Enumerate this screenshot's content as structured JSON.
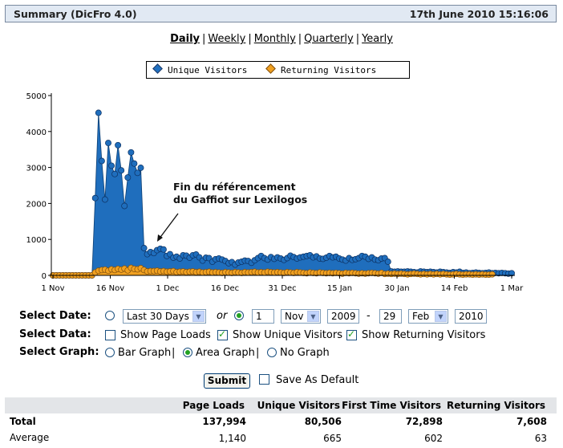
{
  "header": {
    "title": "Summary (DicFro 4.0)",
    "date": "17th June 2010 15:16:06"
  },
  "periods": [
    "Daily",
    "Weekly",
    "Monthly",
    "Quarterly",
    "Yearly"
  ],
  "legend": {
    "unique": "Unique Visitors",
    "returning": "Returning Visitors"
  },
  "colors": {
    "unique": "#1f6ebd",
    "returning": "#f0a020",
    "axis": "#000000"
  },
  "chart_data": {
    "type": "area",
    "ylim": [
      0,
      5000
    ],
    "yticks": [
      "0",
      "1000",
      "2000",
      "3000",
      "4000",
      "5000"
    ],
    "xticks": [
      "1 Nov",
      "16 Nov",
      "1 Dec",
      "16 Dec",
      "31 Dec",
      "15 Jan",
      "30 Jan",
      "14 Feb",
      "1 Mar"
    ],
    "annotation": "Fin du référencement\ndu Gaffiot sur Lexilogos",
    "series": [
      {
        "name": "Unique Visitors",
        "values": [
          0,
          0,
          0,
          0,
          0,
          0,
          0,
          0,
          0,
          0,
          0,
          0,
          0,
          2150,
          4520,
          3180,
          2110,
          3680,
          3050,
          2820,
          3620,
          2920,
          1930,
          2720,
          3420,
          3110,
          2850,
          2990,
          760,
          590,
          650,
          620,
          700,
          740,
          720,
          540,
          590,
          490,
          520,
          470,
          560,
          550,
          490,
          560,
          580,
          500,
          410,
          490,
          480,
          380,
          450,
          470,
          440,
          400,
          340,
          370,
          300,
          360,
          380,
          410,
          400,
          350,
          420,
          480,
          540,
          480,
          440,
          510,
          460,
          500,
          470,
          430,
          480,
          550,
          510,
          470,
          500,
          520,
          540,
          560,
          500,
          530,
          470,
          460,
          490,
          540,
          500,
          520,
          470,
          440,
          410,
          480,
          430,
          450,
          480,
          540,
          520,
          460,
          500,
          440,
          420,
          470,
          480,
          380,
          110,
          100,
          110,
          100,
          100,
          110,
          100,
          90,
          80,
          110,
          100,
          90,
          100,
          90,
          80,
          100,
          90,
          80,
          70,
          90,
          80,
          100,
          70,
          80,
          60,
          70,
          80,
          70,
          60,
          70,
          80,
          60,
          70,
          60,
          70,
          60,
          50,
          60
        ]
      },
      {
        "name": "Returning Visitors",
        "values": [
          0,
          0,
          0,
          0,
          0,
          0,
          0,
          0,
          0,
          0,
          0,
          0,
          0,
          80,
          130,
          150,
          160,
          130,
          170,
          150,
          180,
          160,
          190,
          140,
          210,
          180,
          170,
          200,
          150,
          110,
          120,
          120,
          130,
          110,
          120,
          100,
          110,
          120,
          90,
          100,
          110,
          90,
          100,
          110,
          90,
          100,
          80,
          90,
          100,
          80,
          90,
          80,
          70,
          90,
          80,
          70,
          90,
          80,
          70,
          90,
          80,
          90,
          100,
          80,
          90,
          80,
          100,
          90,
          80,
          90,
          80,
          70,
          90,
          80,
          70,
          90,
          80,
          70,
          60,
          80,
          70,
          60,
          80,
          70,
          60,
          70,
          60,
          70,
          60,
          50,
          70,
          60,
          70,
          60,
          50,
          60,
          50,
          60,
          70,
          60,
          50,
          70,
          40,
          50,
          40,
          50,
          40,
          50,
          40,
          30,
          40,
          50,
          40,
          30,
          40,
          30,
          40,
          30,
          40,
          30,
          40,
          30,
          20,
          30,
          40,
          30,
          20,
          30,
          30,
          20,
          30,
          20,
          30,
          20,
          20,
          30
        ]
      }
    ]
  },
  "form": {
    "select_date_label": "Select Date:",
    "select_data_label": "Select Data:",
    "select_graph_label": "Select Graph:",
    "range_option": "Last 30 Days",
    "or_label": "or",
    "from_day": "1",
    "from_month": "Nov",
    "from_year": "2009",
    "dash": "-",
    "to_day": "29",
    "to_month": "Feb",
    "to_year": "2010",
    "show_page_loads": "Show Page Loads",
    "show_unique": "Show Unique Visitors",
    "show_returning": "Show Returning Visitors",
    "bar_graph": "Bar Graph",
    "area_graph": "Area Graph",
    "no_graph": "No Graph",
    "pipe": "|",
    "submit": "Submit",
    "save_default": "Save As Default"
  },
  "stats": {
    "headers": [
      "Page Loads",
      "Unique Visitors",
      "First Time Visitors",
      "Returning Visitors"
    ],
    "total_label": "Total",
    "total": [
      "137,994",
      "80,506",
      "72,898",
      "7,608"
    ],
    "average_label": "Average",
    "average": [
      "1,140",
      "665",
      "602",
      "63"
    ]
  }
}
